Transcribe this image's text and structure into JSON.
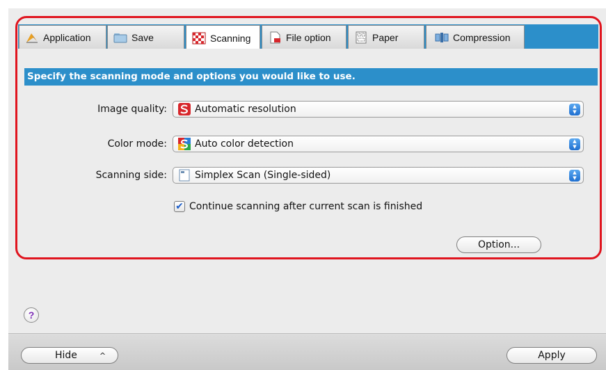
{
  "tabs": [
    {
      "label": "Application",
      "icon": "pen-nib-icon"
    },
    {
      "label": "Save",
      "icon": "folder-icon"
    },
    {
      "label": "Scanning",
      "icon": "checkerboard-icon"
    },
    {
      "label": "File option",
      "icon": "pdf-document-icon"
    },
    {
      "label": "Paper",
      "icon": "paper-size-icon"
    },
    {
      "label": "Compression",
      "icon": "compression-icon"
    }
  ],
  "selected_tab": "Scanning",
  "banner": "Specify the scanning mode and options you would like to use.",
  "fields": {
    "image_quality": {
      "label": "Image quality:",
      "value": "Automatic resolution"
    },
    "color_mode": {
      "label": "Color mode:",
      "value": "Auto color detection"
    },
    "scanning_side": {
      "label": "Scanning side:",
      "value": "Simplex Scan (Single-sided)"
    }
  },
  "checkbox": {
    "label": "Continue scanning after current scan is finished",
    "checked": true
  },
  "buttons": {
    "option": "Option...",
    "hide": "Hide",
    "hide_chevron": "^",
    "apply": "Apply",
    "help": "?"
  },
  "colors": {
    "accent": "#2c8fca",
    "highlight": "#e0141e",
    "scansnap_red": "#d7262b"
  }
}
